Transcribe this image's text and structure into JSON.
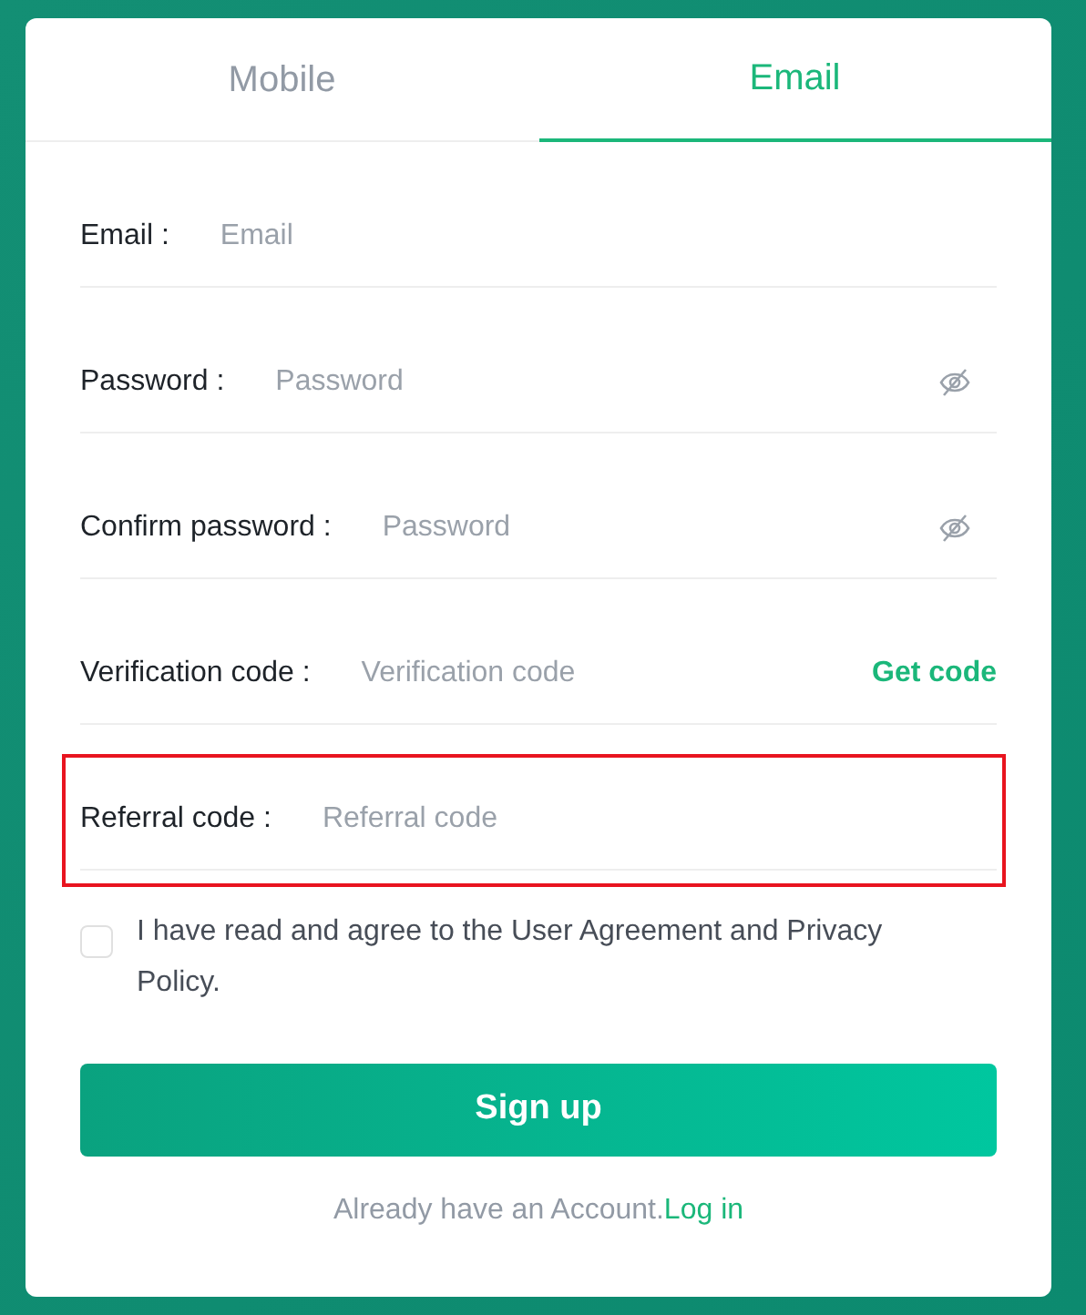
{
  "tabs": [
    {
      "label": "Mobile",
      "selected": false
    },
    {
      "label": "Email",
      "selected": true
    }
  ],
  "fields": [
    {
      "label": "Email :",
      "placeholder": "Email",
      "kind": "text",
      "highlighted": false
    },
    {
      "label": "Password :",
      "placeholder": "Password",
      "kind": "password",
      "highlighted": false
    },
    {
      "label": "Confirm password :",
      "placeholder": "Password",
      "kind": "password",
      "highlighted": false
    },
    {
      "label": "Verification code :",
      "placeholder": "Verification code",
      "kind": "code",
      "action": "Get code",
      "highlighted": false
    },
    {
      "label": "Referral code :",
      "placeholder": "Referral code",
      "kind": "text",
      "highlighted": true
    }
  ],
  "agreement": {
    "text": "I have read and agree to the User Agreement and Privacy Policy.",
    "checked": false
  },
  "submit": "Sign up",
  "footer": {
    "text": "Already have an Account.",
    "link": "Log in"
  }
}
